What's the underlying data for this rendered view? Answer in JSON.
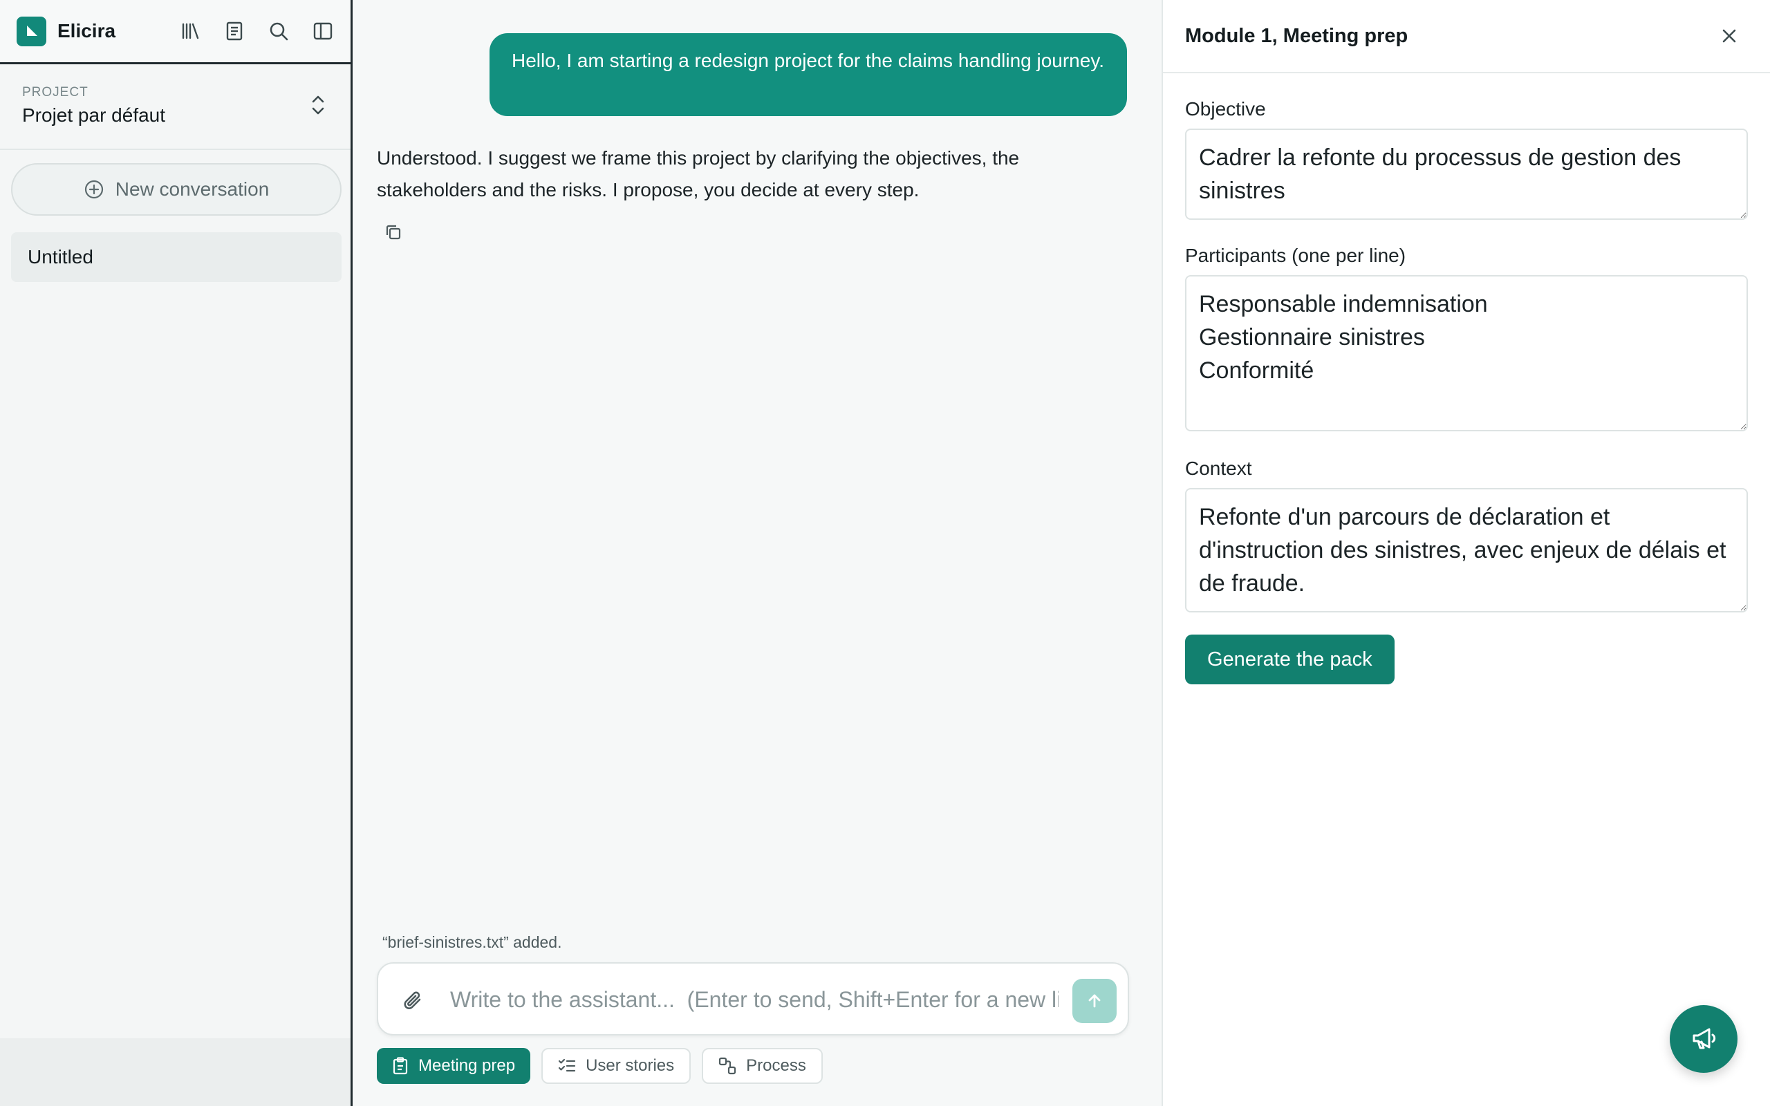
{
  "sidebar": {
    "brand": "Elicira",
    "project_label": "PROJECT",
    "project_name": "Projet par défaut",
    "new_conversation": "New conversation",
    "conversations": [
      "Untitled"
    ]
  },
  "chat": {
    "user_message": "Hello, I am starting a redesign project for the claims handling journey.",
    "assistant_message": "Understood. I suggest we frame this project by clarifying the objectives, the stakeholders and the risks. I propose, you decide at every step.",
    "attachment_note": "“brief-sinistres.txt” added.",
    "composer_placeholder": "Write to the assistant...  (Enter to send, Shift+Enter for a new line)",
    "modules": [
      {
        "label": "Meeting prep",
        "active": true
      },
      {
        "label": "User stories",
        "active": false
      },
      {
        "label": "Process",
        "active": false
      }
    ]
  },
  "panel": {
    "title": "Module 1, Meeting prep",
    "objective_label": "Objective",
    "objective_value": "Cadrer la refonte du processus de gestion des sinistres",
    "participants_label": "Participants (one per line)",
    "participants_value": "Responsable indemnisation\nGestionnaire sinistres\nConformité",
    "context_label": "Context",
    "context_value": "Refonte d'un parcours de déclaration et d'instruction des sinistres, avec enjeux de délais et de fraude.",
    "generate_label": "Generate the pack"
  },
  "colors": {
    "accent": "#12806f",
    "bubble": "#12907f",
    "send_disabled": "#9ed6cd"
  }
}
